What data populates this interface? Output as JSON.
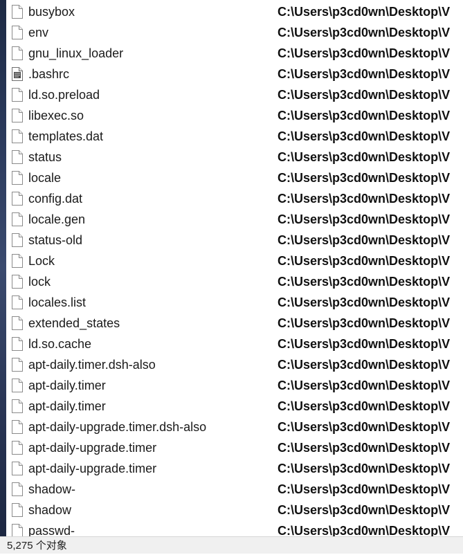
{
  "files": [
    {
      "name": "busybox",
      "path": "C:\\Users\\p3cd0wn\\Desktop\\V",
      "icon": "file-icon"
    },
    {
      "name": "env",
      "path": "C:\\Users\\p3cd0wn\\Desktop\\V",
      "icon": "file-icon"
    },
    {
      "name": "gnu_linux_loader",
      "path": "C:\\Users\\p3cd0wn\\Desktop\\V",
      "icon": "file-icon"
    },
    {
      "name": ".bashrc",
      "path": "C:\\Users\\p3cd0wn\\Desktop\\V",
      "icon": "text-file-icon"
    },
    {
      "name": "ld.so.preload",
      "path": "C:\\Users\\p3cd0wn\\Desktop\\V",
      "icon": "file-icon"
    },
    {
      "name": "libexec.so",
      "path": "C:\\Users\\p3cd0wn\\Desktop\\V",
      "icon": "file-icon"
    },
    {
      "name": "templates.dat",
      "path": "C:\\Users\\p3cd0wn\\Desktop\\V",
      "icon": "file-icon"
    },
    {
      "name": "status",
      "path": "C:\\Users\\p3cd0wn\\Desktop\\V",
      "icon": "file-icon"
    },
    {
      "name": "locale",
      "path": "C:\\Users\\p3cd0wn\\Desktop\\V",
      "icon": "file-icon"
    },
    {
      "name": "config.dat",
      "path": "C:\\Users\\p3cd0wn\\Desktop\\V",
      "icon": "file-icon"
    },
    {
      "name": "locale.gen",
      "path": "C:\\Users\\p3cd0wn\\Desktop\\V",
      "icon": "file-icon"
    },
    {
      "name": "status-old",
      "path": "C:\\Users\\p3cd0wn\\Desktop\\V",
      "icon": "file-icon"
    },
    {
      "name": "Lock",
      "path": "C:\\Users\\p3cd0wn\\Desktop\\V",
      "icon": "file-icon"
    },
    {
      "name": "lock",
      "path": "C:\\Users\\p3cd0wn\\Desktop\\V",
      "icon": "file-icon"
    },
    {
      "name": "locales.list",
      "path": "C:\\Users\\p3cd0wn\\Desktop\\V",
      "icon": "file-icon"
    },
    {
      "name": "extended_states",
      "path": "C:\\Users\\p3cd0wn\\Desktop\\V",
      "icon": "file-icon"
    },
    {
      "name": "ld.so.cache",
      "path": "C:\\Users\\p3cd0wn\\Desktop\\V",
      "icon": "file-icon"
    },
    {
      "name": "apt-daily.timer.dsh-also",
      "path": "C:\\Users\\p3cd0wn\\Desktop\\V",
      "icon": "file-icon"
    },
    {
      "name": "apt-daily.timer",
      "path": "C:\\Users\\p3cd0wn\\Desktop\\V",
      "icon": "file-icon"
    },
    {
      "name": "apt-daily.timer",
      "path": "C:\\Users\\p3cd0wn\\Desktop\\V",
      "icon": "file-icon"
    },
    {
      "name": "apt-daily-upgrade.timer.dsh-also",
      "path": "C:\\Users\\p3cd0wn\\Desktop\\V",
      "icon": "file-icon"
    },
    {
      "name": "apt-daily-upgrade.timer",
      "path": "C:\\Users\\p3cd0wn\\Desktop\\V",
      "icon": "file-icon"
    },
    {
      "name": "apt-daily-upgrade.timer",
      "path": "C:\\Users\\p3cd0wn\\Desktop\\V",
      "icon": "file-icon"
    },
    {
      "name": "shadow-",
      "path": "C:\\Users\\p3cd0wn\\Desktop\\V",
      "icon": "file-icon"
    },
    {
      "name": "shadow",
      "path": "C:\\Users\\p3cd0wn\\Desktop\\V",
      "icon": "file-icon"
    },
    {
      "name": "passwd-",
      "path": "C:\\Users\\p3cd0wn\\Desktop\\V",
      "icon": "file-icon"
    }
  ],
  "status_bar": {
    "item_count": "5,275 个对象"
  },
  "colors": {
    "background": "#ffffff",
    "status_bar": "#f0f0f0",
    "text": "#1a1a1a"
  }
}
